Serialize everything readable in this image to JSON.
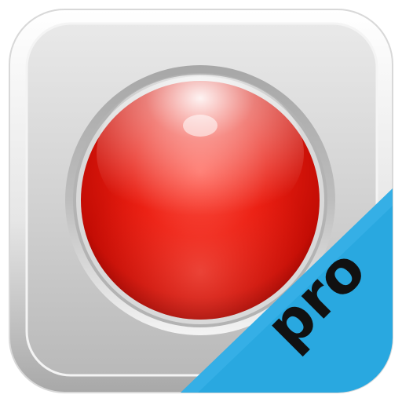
{
  "icon": {
    "badge_label": "pro",
    "central_element": "record-button-icon",
    "colors": {
      "tile_light": "#f2f2f2",
      "tile_mid": "#cfcfcf",
      "tile_dark": "#9e9e9e",
      "button_red": "#e01a10",
      "button_red_dark": "#9c0500",
      "badge_blue": "#29a8e0",
      "badge_text": "#111111"
    }
  }
}
